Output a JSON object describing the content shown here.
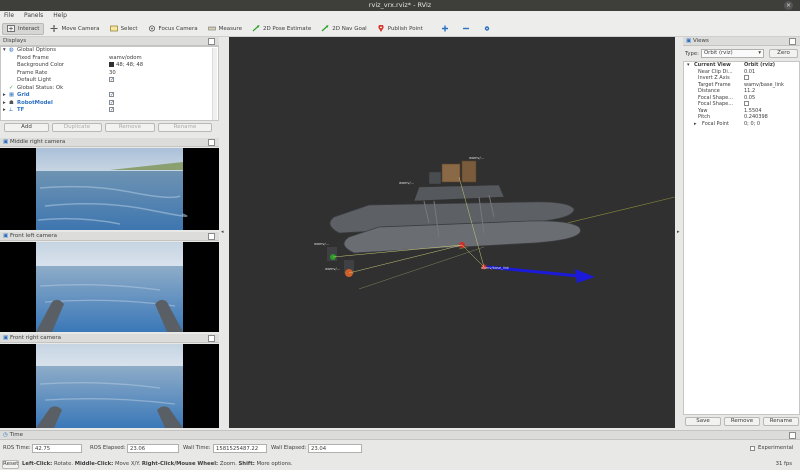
{
  "window": {
    "title": "rviz_vrx.rviz* - RViz",
    "close": "×"
  },
  "menu": [
    "File",
    "Panels",
    "Help"
  ],
  "toolbar": {
    "interact": "Interact",
    "move_camera": "Move Camera",
    "select": "Select",
    "focus_camera": "Focus Camera",
    "measure": "Measure",
    "pose_estimate": "2D Pose Estimate",
    "nav_goal": "2D Nav Goal",
    "publish_point": "Publish Point"
  },
  "displays": {
    "title": "Displays",
    "global_options": "Global Options",
    "fixed_frame_label": "Fixed Frame",
    "fixed_frame": "wamv/odom",
    "bg_color_label": "Background Color",
    "bg_color": "48; 48; 48",
    "frame_rate_label": "Frame Rate",
    "frame_rate": "30",
    "default_light_label": "Default Light",
    "global_status": "Global Status: Ok",
    "grid": "Grid",
    "robot_model": "RobotModel",
    "tf": "TF",
    "buttons": {
      "add": "Add",
      "duplicate": "Duplicate",
      "remove": "Remove",
      "rename": "Rename"
    }
  },
  "cameras": {
    "middle_right": "Middle right camera",
    "front_left": "Front left camera",
    "front_right": "Front right camera"
  },
  "scene_labels": {
    "l1": "wamv/...",
    "l2": "wamv/base_link",
    "l3": "wamv/...",
    "l4": "wamv/...",
    "l5": "wamv/..."
  },
  "views": {
    "title": "Views",
    "type_label": "Type:",
    "type_value": "Orbit (rviz)",
    "zero": "Zero",
    "current_view": "Current View",
    "current_view_value": "Orbit (rviz)",
    "props": [
      {
        "k": "Near Clip Di...",
        "v": "0.01"
      },
      {
        "k": "Invert Z Axis",
        "v": ""
      },
      {
        "k": "Target Frame",
        "v": "wamv/base_link"
      },
      {
        "k": "Distance",
        "v": "11.2"
      },
      {
        "k": "Focal Shape...",
        "v": "0.05"
      },
      {
        "k": "Focal Shape...",
        "v": ""
      },
      {
        "k": "Yaw",
        "v": "1.5504"
      },
      {
        "k": "Pitch",
        "v": "0.240398"
      },
      {
        "k": "Focal Point",
        "v": "0; 0; 0"
      }
    ],
    "save": "Save",
    "remove": "Remove",
    "rename": "Rename"
  },
  "time": {
    "title": "Time",
    "ros_time_label": "ROS Time:",
    "ros_time": "42.75",
    "ros_elapsed_label": "ROS Elapsed:",
    "ros_elapsed": "23.06",
    "wall_time_label": "Wall Time:",
    "wall_time": "1581525487.22",
    "wall_elapsed_label": "Wall Elapsed:",
    "wall_elapsed": "23.04",
    "experimental": "Experimental"
  },
  "status": {
    "reset": "Reset",
    "left_click": "Left-Click:",
    "left_click_desc": "Rotate.",
    "middle_click": "Middle-Click:",
    "middle_click_desc": "Move X/Y.",
    "right_click": "Right-Click/Mouse Wheel:",
    "right_click_desc": "Zoom.",
    "shift": "Shift:",
    "shift_desc": "More options.",
    "fps": "31 fps"
  },
  "colors": {
    "viewport_bg": "#303030",
    "accent_blue": "#2a6fc2",
    "axis_blue": "#1a1ad8"
  }
}
